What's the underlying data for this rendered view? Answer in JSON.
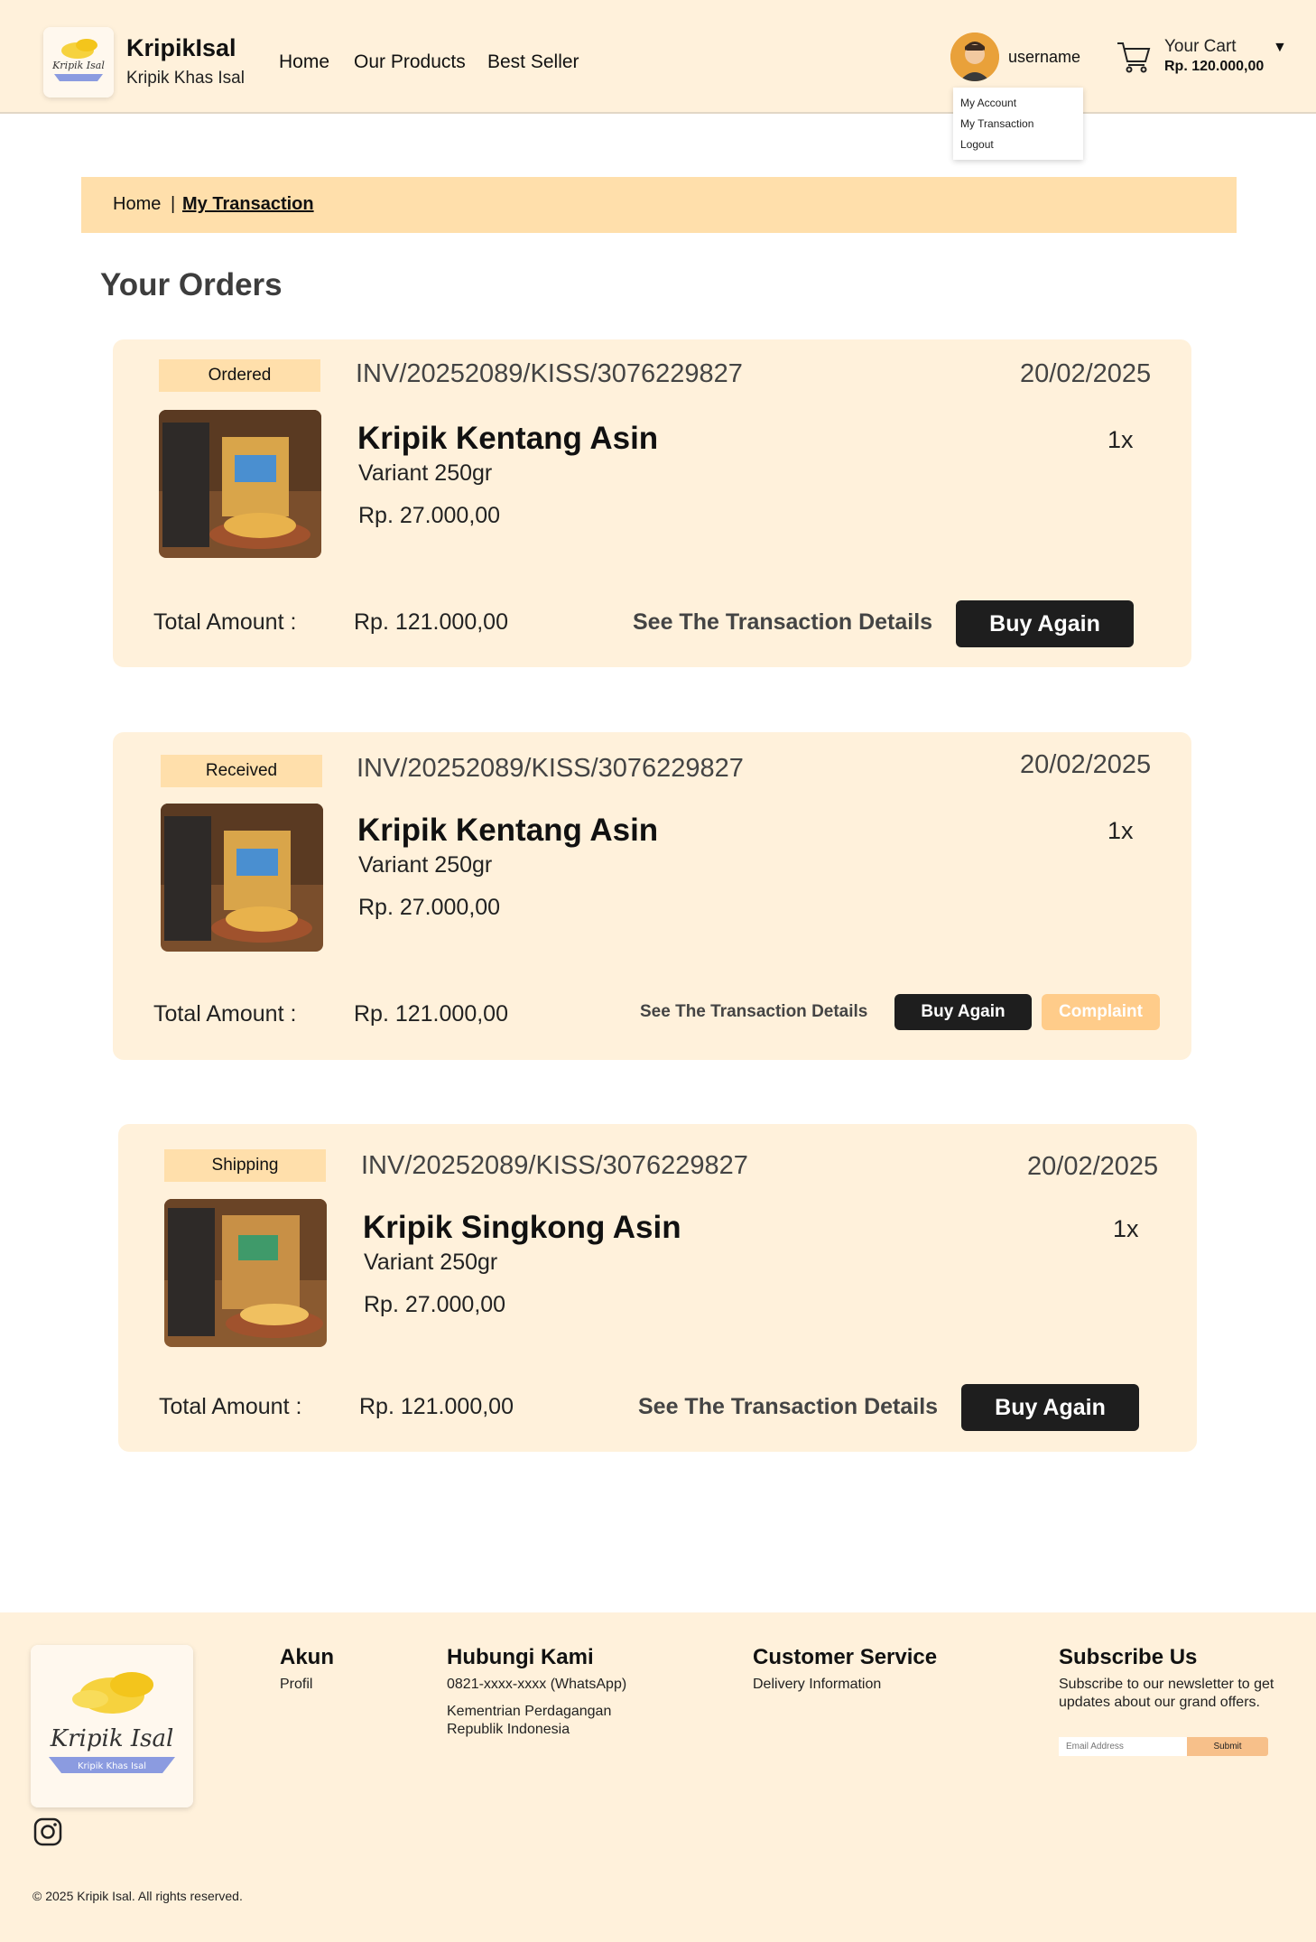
{
  "header": {
    "brand_name": "KripikIsal",
    "brand_tagline": "Kripik Khas Isal",
    "logo_text": "Kripik Isal",
    "nav": [
      "Home",
      "Our Products",
      "Best Seller"
    ],
    "username": "username",
    "cart_label": "Your Cart",
    "cart_total": "Rp. 120.000,00",
    "dropdown": [
      "My Account",
      "My Transaction",
      "Logout"
    ]
  },
  "breadcrumb": {
    "home": "Home",
    "separator": "|",
    "current": "My Transaction"
  },
  "page_title": "Your Orders",
  "orders": [
    {
      "status": "Ordered",
      "invoice": "INV/20252089/KISS/3076229827",
      "date": "20/02/2025",
      "product_name": "Kripik Kentang Asin",
      "variant": "Variant 250gr",
      "price": "Rp. 27.000,00",
      "qty": "1x",
      "total_label": "Total Amount :",
      "total_value": "Rp. 121.000,00",
      "details_label": "See The Transaction Details",
      "buy_again_label": "Buy Again"
    },
    {
      "status": "Received",
      "invoice": "INV/20252089/KISS/3076229827",
      "date": "20/02/2025",
      "product_name": "Kripik Kentang Asin",
      "variant": "Variant 250gr",
      "price": "Rp. 27.000,00",
      "qty": "1x",
      "total_label": "Total Amount :",
      "total_value": "Rp. 121.000,00",
      "details_label": "See The Transaction Details",
      "buy_again_label": "Buy Again",
      "complaint_label": "Complaint"
    },
    {
      "status": "Shipping",
      "invoice": "INV/20252089/KISS/3076229827",
      "date": "20/02/2025",
      "product_name": "Kripik Singkong Asin",
      "variant": "Variant 250gr",
      "price": "Rp. 27.000,00",
      "qty": "1x",
      "total_label": "Total Amount :",
      "total_value": "Rp. 121.000,00",
      "details_label": "See The Transaction Details",
      "buy_again_label": "Buy Again"
    }
  ],
  "footer": {
    "logo_text": "Kripik Isal",
    "logo_ribbon": "Kripik Khas Isal",
    "akun_title": "Akun",
    "akun_link": "Profil",
    "contact_title": "Hubungi Kami",
    "contact_phone": "0821-xxxx-xxxx (WhatsApp)",
    "contact_line1": "Kementrian Perdagangan",
    "contact_line2": "Republik Indonesia",
    "cs_title": "Customer Service",
    "cs_link": "Delivery Information",
    "subscribe_title": "Subscribe Us",
    "subscribe_text": "Subscribe to our newsletter to get updates about our grand offers.",
    "email_placeholder": "Email Address",
    "submit_label": "Submit",
    "copyright": "© 2025 Kripik Isal. All rights reserved."
  },
  "colors": {
    "cream": "#fff1db",
    "peach": "#ffdfab",
    "dark_button": "#1e1e1e",
    "complaint": "#ffcc8a"
  }
}
